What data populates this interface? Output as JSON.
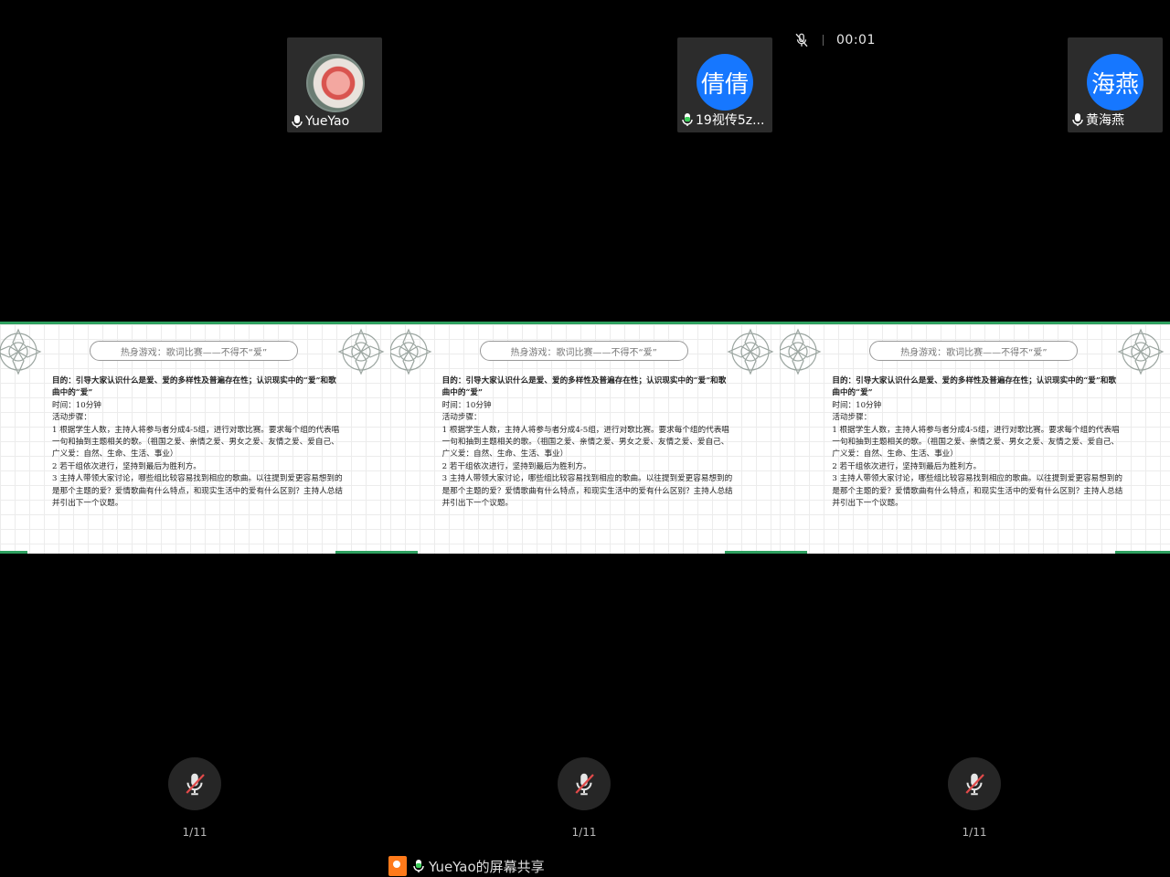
{
  "status": {
    "timer": "00:01"
  },
  "participants": [
    {
      "name": "YueYao",
      "avatar_text": ""
    },
    {
      "name": "19视传5z...",
      "avatar_text": "倩倩"
    },
    {
      "name": "黄海燕",
      "avatar_text": "海燕"
    }
  ],
  "slide": {
    "title": "热身游戏：歌词比赛——不得不“爱”",
    "lines": [
      "目的：引导大家认识什么是爱、爱的多样性及普遍存在性；认识现实中的“爱”和歌曲中的“爱”",
      "时间：10分钟",
      "活动步骤：",
      "1 根据学生人数，主持人将参与者分成4-5组，进行对歌比赛。要求每个组的代表唱一句和抽到主题相关的歌。（祖国之爱、亲情之爱、男女之爱、友情之爱、爱自己、广义爱：自然、生命、生活、事业）",
      "2 若干组依次进行，坚持到最后为胜利方。",
      "3 主持人带领大家讨论，哪些组比较容易找到相应的歌曲。以往提到爱更容易想到的是那个主题的爱？爱情歌曲有什么特点，和现实生活中的爱有什么区别？主持人总结并引出下一个议题。"
    ]
  },
  "page_indicator": "1/11",
  "share": {
    "label": "YueYao的屏幕共享"
  },
  "colors": {
    "accent_green": "#2ea05f",
    "avatar_blue": "#1677ff",
    "share_orange": "#ff7a1a"
  }
}
